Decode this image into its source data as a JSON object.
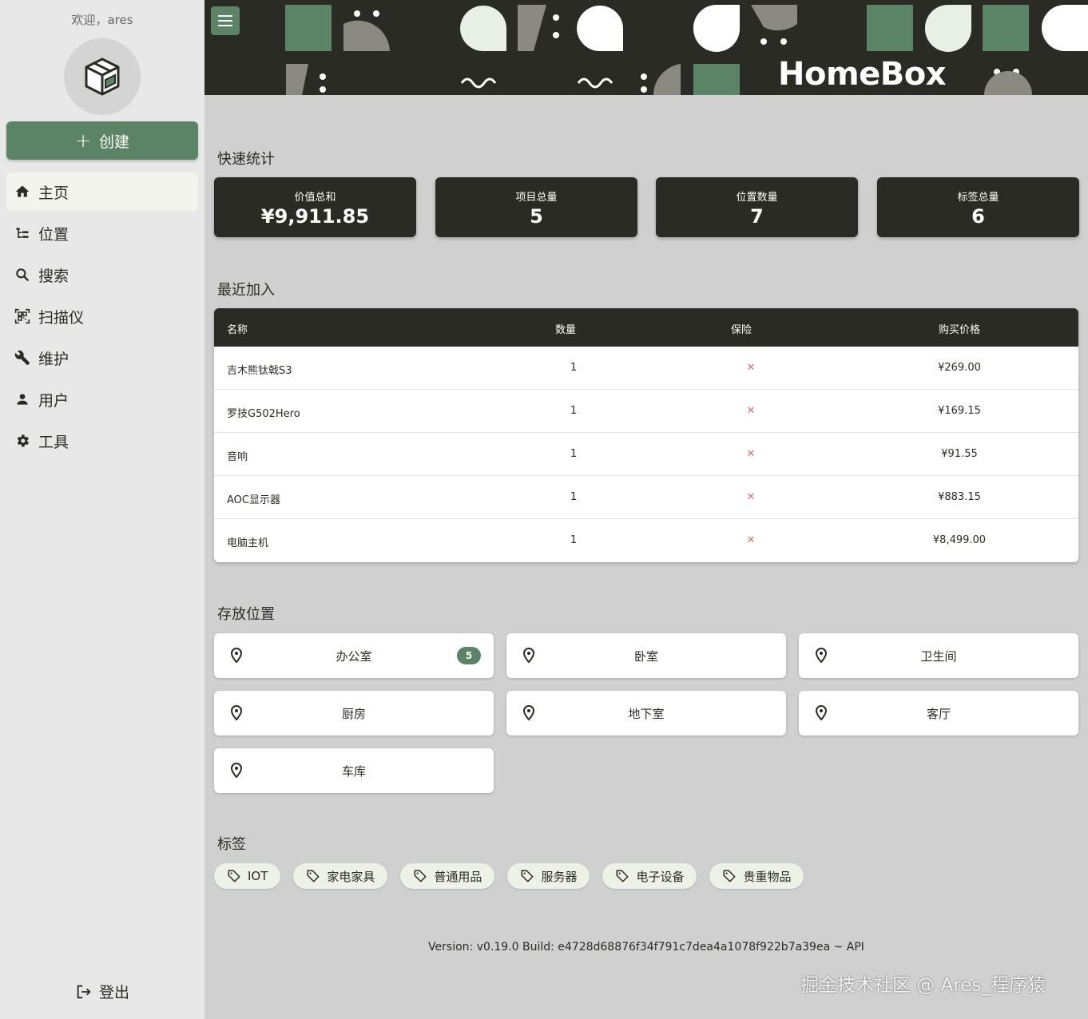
{
  "sidebar": {
    "welcome": "欢迎，ares",
    "create_label": "创建",
    "nav": [
      {
        "label": "主页",
        "icon": "home-icon"
      },
      {
        "label": "位置",
        "icon": "tree-icon"
      },
      {
        "label": "搜索",
        "icon": "search-icon"
      },
      {
        "label": "扫描仪",
        "icon": "qr-icon"
      },
      {
        "label": "维护",
        "icon": "wrench-icon"
      },
      {
        "label": "用户",
        "icon": "user-icon"
      },
      {
        "label": "工具",
        "icon": "gear-icon"
      }
    ],
    "logout_label": "登出"
  },
  "header": {
    "brand": "HomeBox"
  },
  "stats": {
    "title": "快速统计",
    "items": [
      {
        "label": "价值总和",
        "value": "¥9,911.85"
      },
      {
        "label": "项目总量",
        "value": "5"
      },
      {
        "label": "位置数量",
        "value": "7"
      },
      {
        "label": "标签总量",
        "value": "6"
      }
    ]
  },
  "recent": {
    "title": "最近加入",
    "columns": [
      "名称",
      "数量",
      "保险",
      "购买价格"
    ],
    "rows": [
      {
        "name": "吉木熊钛戟S3",
        "qty": "1",
        "insured": "✕",
        "price": "¥269.00"
      },
      {
        "name": "罗技G502Hero",
        "qty": "1",
        "insured": "✕",
        "price": "¥169.15"
      },
      {
        "name": "音响",
        "qty": "1",
        "insured": "✕",
        "price": "¥91.55"
      },
      {
        "name": "AOC显示器",
        "qty": "1",
        "insured": "✕",
        "price": "¥883.15"
      },
      {
        "name": "电脑主机",
        "qty": "1",
        "insured": "✕",
        "price": "¥8,499.00"
      }
    ]
  },
  "locations": {
    "title": "存放位置",
    "items": [
      {
        "name": "办公室",
        "count": "5"
      },
      {
        "name": "卧室"
      },
      {
        "name": "卫生间"
      },
      {
        "name": "厨房"
      },
      {
        "name": "地下室"
      },
      {
        "name": "客厅"
      },
      {
        "name": "车库"
      }
    ]
  },
  "labels": {
    "title": "标签",
    "items": [
      "IOT",
      "家电家具",
      "普通用品",
      "服务器",
      "电子设备",
      "贵重物品"
    ]
  },
  "footer": {
    "version": "Version: v0.19.0 Build: e4728d68876f34f791c7dea4a1078f922b7a39ea ~ API"
  },
  "watermark": "掘金技术社区 @ Ares_程序猿",
  "colors": {
    "accent": "#5b8466",
    "dark": "#2b2b25",
    "danger": "#e06c6c",
    "tag_bg": "#eef1e6"
  }
}
